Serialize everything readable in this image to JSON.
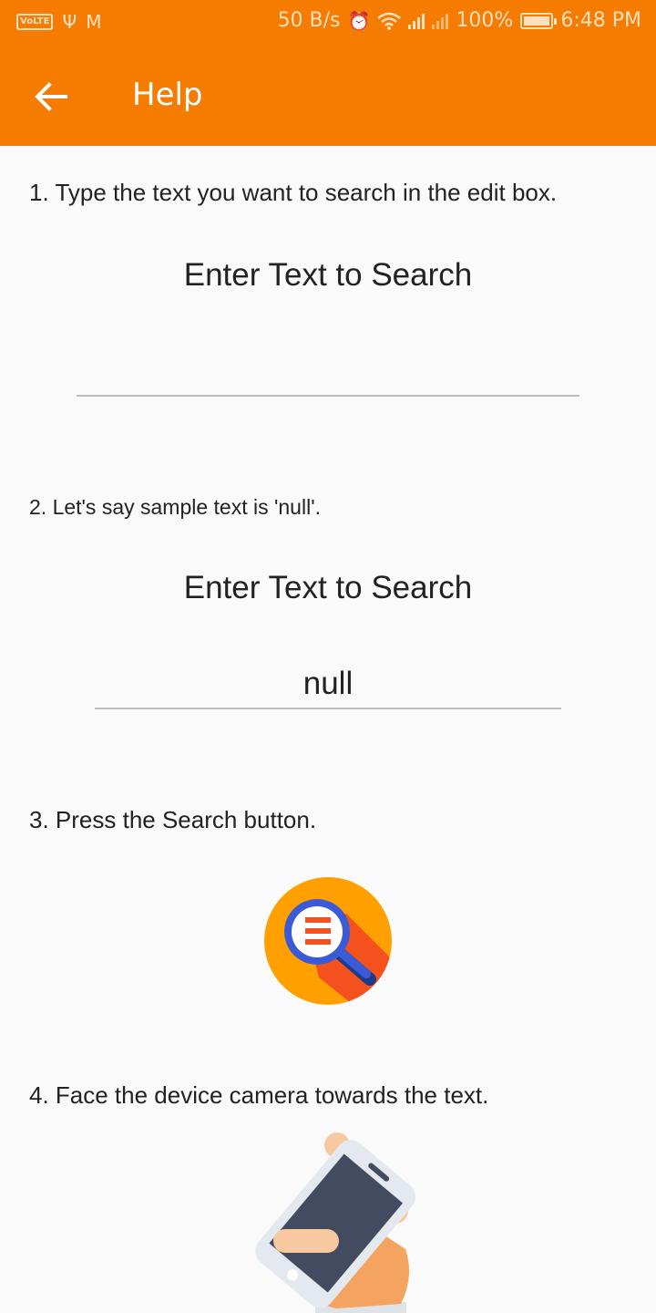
{
  "status_bar": {
    "volte": "VoLTE",
    "speed": "50 B/s",
    "battery": "100%",
    "time": "6:48 PM"
  },
  "app_bar": {
    "title": "Help"
  },
  "steps": {
    "step1": "1. Type the text you want to search in the edit box.",
    "step2": "2. Let's say sample text is 'null'.",
    "step3": "3. Press the Search button.",
    "step4": "4. Face the device camera towards the text."
  },
  "demo1": {
    "label": "Enter Text to Search",
    "value": ""
  },
  "demo2": {
    "label": "Enter Text to Search",
    "value": "null"
  },
  "colors": {
    "primary": "#f57c00",
    "search_icon_bg": "#ffa000",
    "search_icon_lens": "#3b5bd6",
    "search_icon_lines": "#f4511e"
  }
}
